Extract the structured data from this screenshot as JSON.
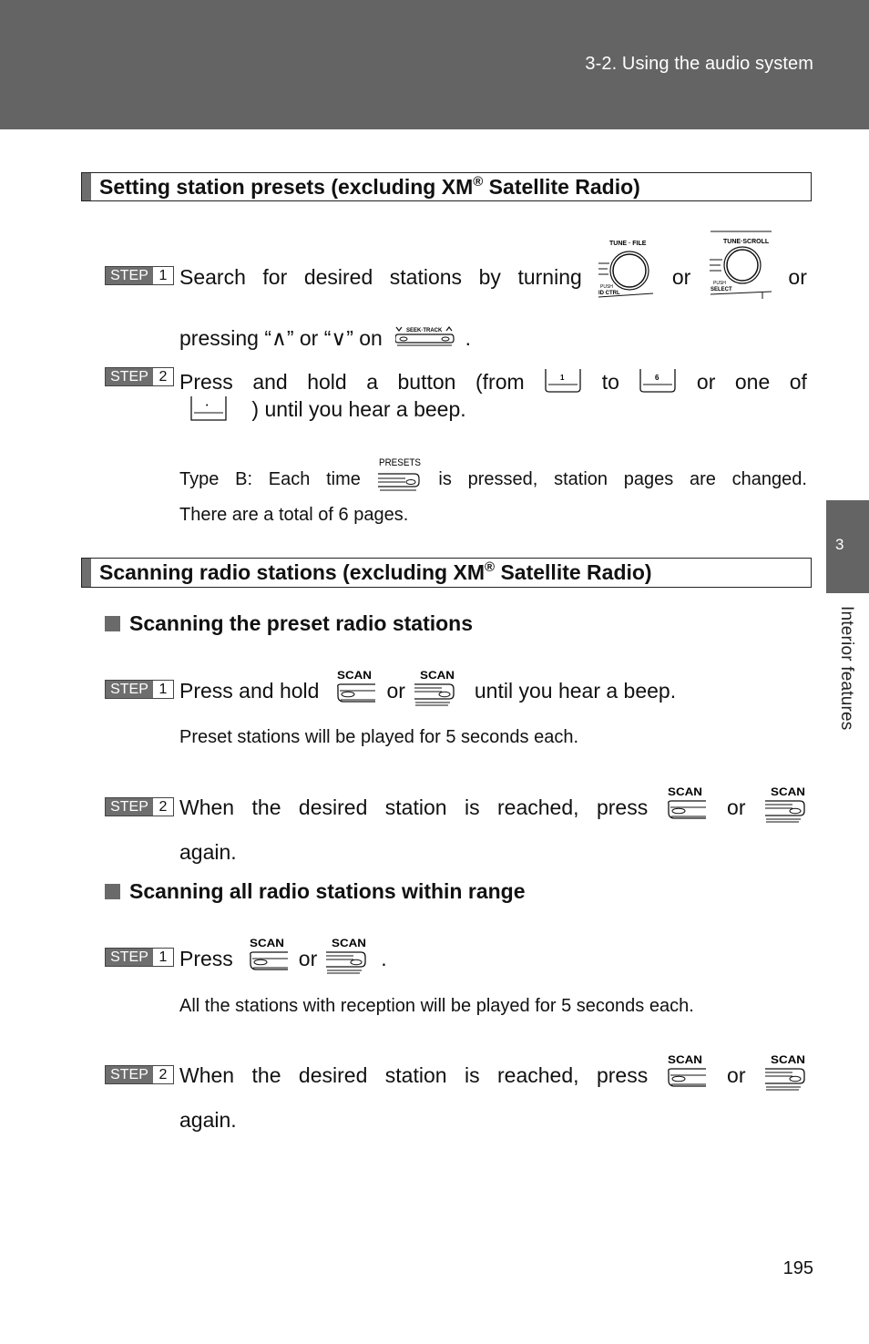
{
  "header": {
    "title": "3-2. Using the audio system"
  },
  "side_tab": {
    "number": "3",
    "label": "Interior features"
  },
  "sections": [
    {
      "title_prefix": "Setting station presets (excluding XM",
      "title_sup": "®",
      "title_suffix": " Satellite Radio)",
      "steps": [
        {
          "badge": "STEP",
          "number": "1",
          "line1_words": [
            "Search",
            "for",
            "desired",
            "stations",
            "by",
            "turning"
          ],
          "or1": "or",
          "or2": "or",
          "knob1_label": "TUNE · FILE",
          "knob1_sub1": "PUSH",
          "knob1_sub2": "ID CTRL",
          "knob2_label": "TUNE·SCROLL",
          "knob2_sub1": "PUSH",
          "knob2_sub2": "SELECT",
          "line2_prefix": "pressing “∧” or “∨” on",
          "seek_label": "SEEK·TRACK",
          "line2_suffix": "."
        },
        {
          "badge": "STEP",
          "number": "2",
          "line1_words": [
            "Press",
            "and",
            "hold",
            "a",
            "button",
            "(from"
          ],
          "btn_from": "1",
          "to": "to",
          "btn_to": "6",
          "line1_tail_words": [
            "or",
            "one",
            "of"
          ],
          "btn_dot": "•",
          "line2": ") until you hear a beep."
        }
      ],
      "note": {
        "prefix_words": [
          "Type",
          "B:",
          "Each",
          "time"
        ],
        "button_label": "PRESETS",
        "suffix_words": [
          "is",
          "pressed,",
          "station",
          "pages",
          "are",
          "changed."
        ],
        "line2": "There are a total of 6 pages."
      }
    },
    {
      "title_prefix": "Scanning radio stations (excluding XM",
      "title_sup": "®",
      "title_suffix": " Satellite Radio)",
      "subsections": [
        {
          "title": "Scanning the preset radio stations",
          "steps": [
            {
              "badge": "STEP",
              "number": "1",
              "prefix": "Press and hold",
              "or": "or",
              "suffix": "until you hear a beep.",
              "scan_label": "SCAN"
            },
            {
              "badge": "STEP",
              "number": "2",
              "words": [
                "When",
                "the",
                "desired",
                "station",
                "is",
                "reached,",
                "press"
              ],
              "or": "or",
              "line2": "again.",
              "scan_label": "SCAN"
            }
          ],
          "note": "Preset stations will be played for 5 seconds each."
        },
        {
          "title": "Scanning all radio stations within range",
          "steps": [
            {
              "badge": "STEP",
              "number": "1",
              "prefix": "Press",
              "or": "or",
              "suffix": ".",
              "scan_label": "SCAN"
            },
            {
              "badge": "STEP",
              "number": "2",
              "words": [
                "When",
                "the",
                "desired",
                "station",
                "is",
                "reached,",
                "press"
              ],
              "or": "or",
              "line2": "again.",
              "scan_label": "SCAN"
            }
          ],
          "note": "All the stations with reception will be played for 5 seconds each."
        }
      ]
    }
  ],
  "page_number": "195"
}
